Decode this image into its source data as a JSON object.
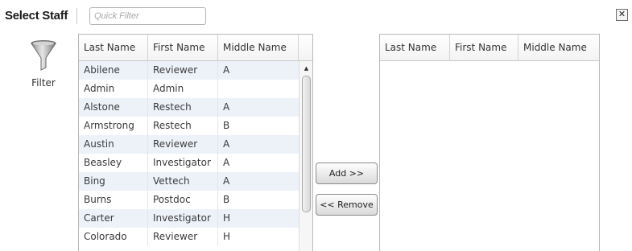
{
  "header": {
    "title": "Select Staff",
    "quick_filter_placeholder": "Quick Filter",
    "quick_filter_value": "",
    "close_glyph": "✕"
  },
  "filter_tool": {
    "icon": "funnel-icon",
    "label": "Filter"
  },
  "available_grid": {
    "columns": [
      "Last Name",
      "First Name",
      "Middle Name"
    ],
    "rows": [
      [
        "Abilene",
        "Reviewer",
        "A"
      ],
      [
        "Admin",
        "Admin",
        ""
      ],
      [
        "Alstone",
        "Restech",
        "A"
      ],
      [
        "Armstrong",
        "Restech",
        "B"
      ],
      [
        "Austin",
        "Reviewer",
        "A"
      ],
      [
        "Beasley",
        "Investigator",
        "A"
      ],
      [
        "Bing",
        "Vettech",
        "A"
      ],
      [
        "Burns",
        "Postdoc",
        "B"
      ],
      [
        "Carter",
        "Investigator",
        "H"
      ],
      [
        "Colorado",
        "Reviewer",
        "H"
      ]
    ]
  },
  "actions": {
    "add_label": "Add >>",
    "remove_label": "<< Remove"
  },
  "selected_grid": {
    "columns": [
      "Last Name",
      "First Name",
      "Middle Name"
    ],
    "rows": []
  }
}
